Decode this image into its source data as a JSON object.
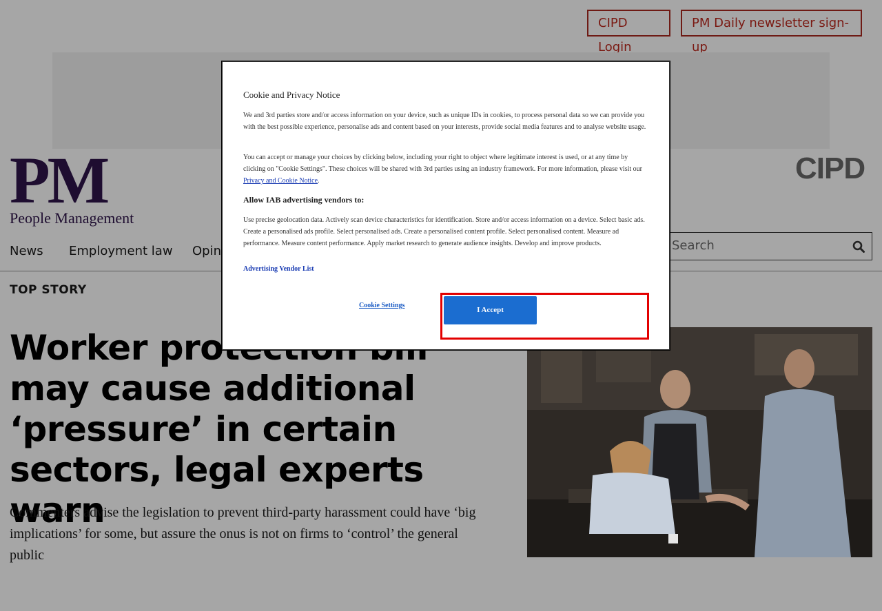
{
  "header": {
    "login_label": "CIPD Login",
    "newsletter_label": "PM Daily newsletter sign-up"
  },
  "logo": {
    "mark": "PM",
    "subtitle": "People Management",
    "partner": "CIPD"
  },
  "nav": {
    "items": [
      "News",
      "Employment law",
      "Opini"
    ]
  },
  "search": {
    "placeholder": "Search"
  },
  "article": {
    "section": "TOP STORY",
    "headline": "Worker protection bill may cause additional ‘pressure’ in certain sectors, legal experts warn",
    "standfirst": "Commenters advise the legislation to prevent third-party harassment could have ‘big implications’ for some, but assure the onus is not on firms to ‘control’ the general public"
  },
  "cookie_modal": {
    "title": "Cookie and Privacy Notice",
    "para1": "We and 3rd parties store and/or access information on your device, such as unique IDs in cookies, to process personal data so we can provide you with the best possible experience, personalise ads and content based on your interests, provide social media features and to analyse website usage.",
    "para2_before_link": "You can accept or manage your choices by clicking below, including your right to object where legitimate interest is used, or at any time by clicking on \"Cookie Settings\". These choices will be shared with 3rd parties using an industry framework. For more information, please visit our ",
    "para2_link": "Privacy and Cookie Notice",
    "para2_after_link": ".",
    "subheading": "Allow IAB advertising vendors to:",
    "para3": "Use precise geolocation data. Actively scan device characteristics for identification. Store and/or access information on a device. Select basic ads. Create a personalised ads profile. Select personalised ads. Create a personalised content profile. Select personalised content. Measure ad performance. Measure content performance. Apply market research to generate audience insights. Develop and improve products.",
    "vendor_link": "Advertising Vendor List",
    "settings_label": "Cookie Settings",
    "accept_label": "I Accept"
  },
  "colors": {
    "accent_red": "#7a1912",
    "accept_blue": "#1b6dd0",
    "highlight": "#e30000"
  }
}
